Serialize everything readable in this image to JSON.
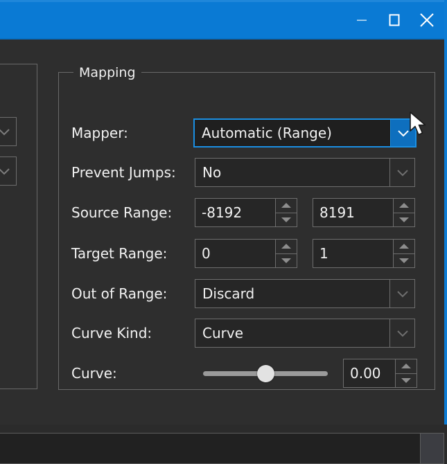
{
  "window": {
    "title": "",
    "accent_color": "#0a7ad4",
    "background_color": "#2e2e2e",
    "border_color": "#0c7cd5"
  },
  "titlebar": {
    "minimize_label": "minimize",
    "maximize_label": "maximize",
    "close_label": "close"
  },
  "groupbox": {
    "title": "Mapping"
  },
  "form": {
    "rows": [
      {
        "label": "Mapper:",
        "type": "combobox",
        "value": "Automatic (Range)",
        "focused": true
      },
      {
        "label": "Prevent Jumps:",
        "type": "combobox",
        "value": "No",
        "focused": false
      },
      {
        "label": "Source Range:",
        "type": "spin-pair",
        "value_min": "-8192",
        "value_max": "8191"
      },
      {
        "label": "Target Range:",
        "type": "spin-pair",
        "value_min": "0",
        "value_max": "1"
      },
      {
        "label": "Out of Range:",
        "type": "combobox",
        "value": "Discard",
        "focused": false
      },
      {
        "label": "Curve Kind:",
        "type": "combobox",
        "value": "Curve",
        "focused": false
      },
      {
        "label": "Curve:",
        "type": "slider-spin",
        "value": "0.00",
        "slider_percent": 50
      }
    ]
  },
  "icons": {
    "chevron_down": "chevron-down-icon",
    "spin_up": "triangle-up-icon",
    "spin_down": "triangle-down-icon",
    "cursor": "arrow-cursor"
  }
}
